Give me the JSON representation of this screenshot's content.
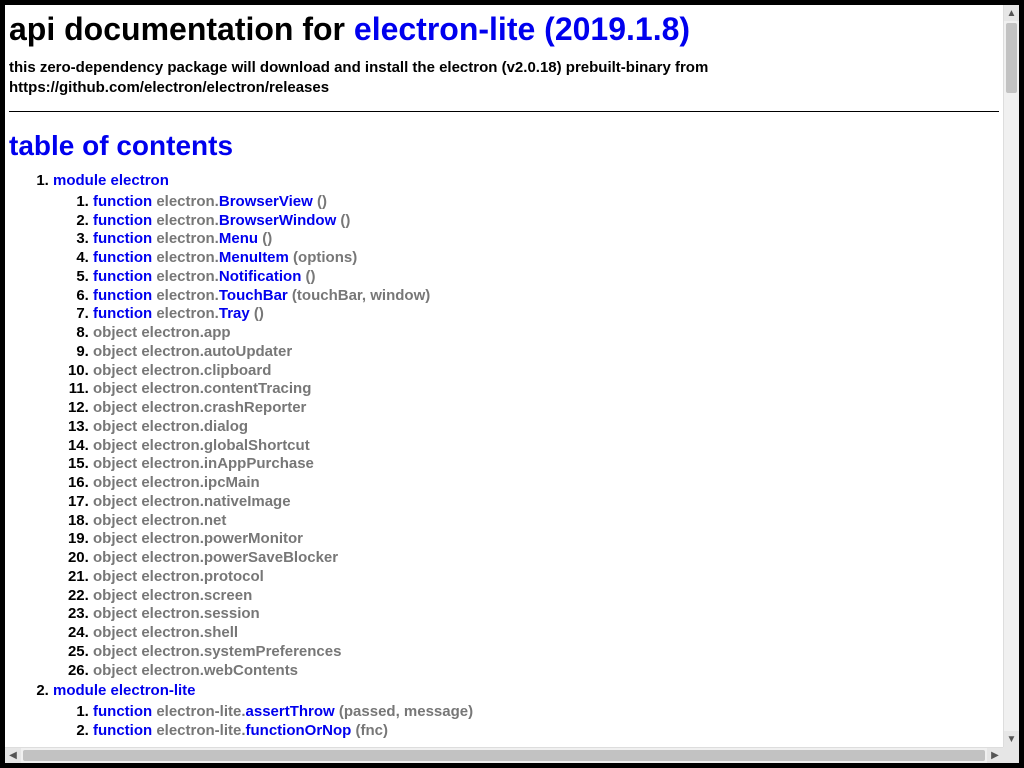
{
  "header": {
    "title_prefix": "api documentation for ",
    "title_link": "electron-lite (2019.1.8)",
    "subtitle": "this zero-dependency package will download and install the electron (v2.0.18) prebuilt-binary from https://github.com/electron/electron/releases"
  },
  "toc": {
    "heading": "table of contents",
    "modules": [
      {
        "label": "module electron",
        "items": [
          {
            "kind": "function",
            "prefix": "electron.",
            "name": "BrowserView",
            "params": "()"
          },
          {
            "kind": "function",
            "prefix": "electron.",
            "name": "BrowserWindow",
            "params": "()"
          },
          {
            "kind": "function",
            "prefix": "electron.",
            "name": "Menu",
            "params": "()"
          },
          {
            "kind": "function",
            "prefix": "electron.",
            "name": "MenuItem",
            "params": "(options)"
          },
          {
            "kind": "function",
            "prefix": "electron.",
            "name": "Notification",
            "params": "()"
          },
          {
            "kind": "function",
            "prefix": "electron.",
            "name": "TouchBar",
            "params": "(touchBar, window)"
          },
          {
            "kind": "function",
            "prefix": "electron.",
            "name": "Tray",
            "params": "()"
          },
          {
            "kind": "object",
            "text": "object electron.app"
          },
          {
            "kind": "object",
            "text": "object electron.autoUpdater"
          },
          {
            "kind": "object",
            "text": "object electron.clipboard"
          },
          {
            "kind": "object",
            "text": "object electron.contentTracing"
          },
          {
            "kind": "object",
            "text": "object electron.crashReporter"
          },
          {
            "kind": "object",
            "text": "object electron.dialog"
          },
          {
            "kind": "object",
            "text": "object electron.globalShortcut"
          },
          {
            "kind": "object",
            "text": "object electron.inAppPurchase"
          },
          {
            "kind": "object",
            "text": "object electron.ipcMain"
          },
          {
            "kind": "object",
            "text": "object electron.nativeImage"
          },
          {
            "kind": "object",
            "text": "object electron.net"
          },
          {
            "kind": "object",
            "text": "object electron.powerMonitor"
          },
          {
            "kind": "object",
            "text": "object electron.powerSaveBlocker"
          },
          {
            "kind": "object",
            "text": "object electron.protocol"
          },
          {
            "kind": "object",
            "text": "object electron.screen"
          },
          {
            "kind": "object",
            "text": "object electron.session"
          },
          {
            "kind": "object",
            "text": "object electron.shell"
          },
          {
            "kind": "object",
            "text": "object electron.systemPreferences"
          },
          {
            "kind": "object",
            "text": "object electron.webContents"
          }
        ]
      },
      {
        "label": "module electron-lite",
        "items": [
          {
            "kind": "function",
            "prefix": "electron-lite.",
            "name": "assertThrow",
            "params": "(passed, message)"
          },
          {
            "kind": "function",
            "prefix": "electron-lite.",
            "name": "functionOrNop",
            "params": "(fnc)"
          }
        ]
      }
    ]
  },
  "labels": {
    "function_keyword": "function"
  }
}
